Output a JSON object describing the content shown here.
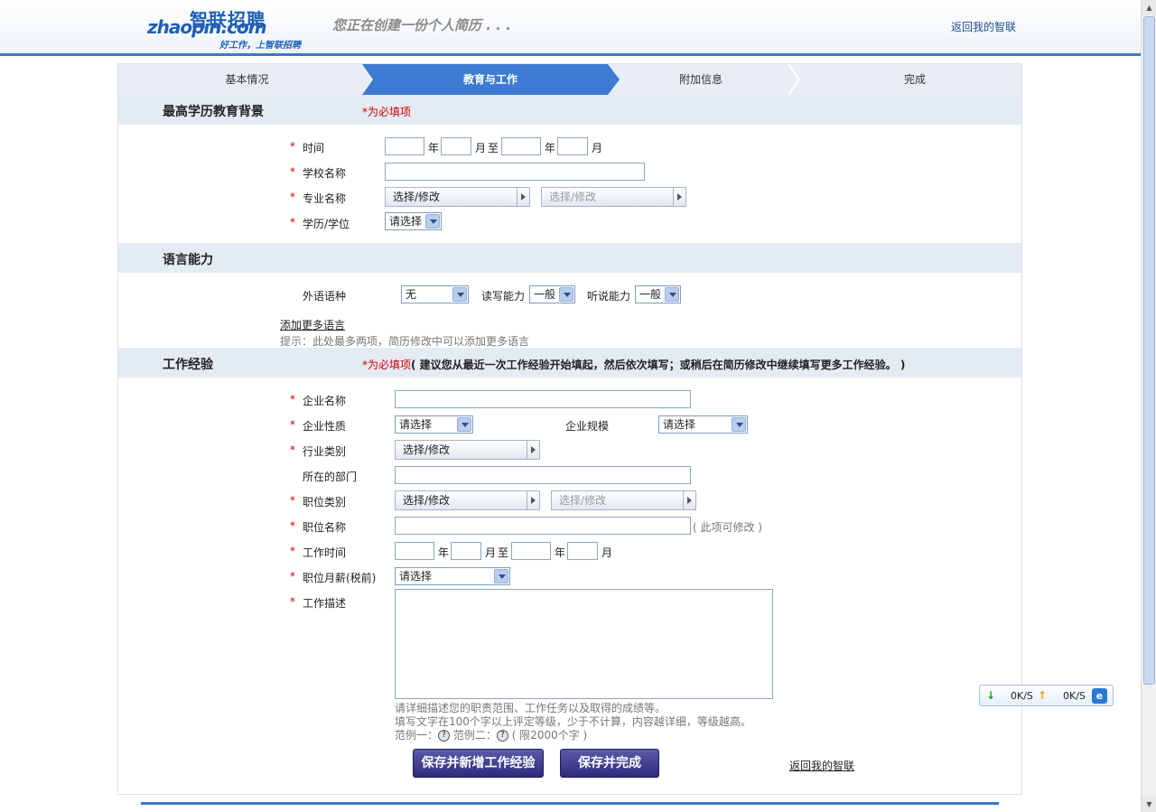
{
  "header": {
    "logo_cn": "智联招聘",
    "logo_en": "zhaopin.com",
    "logo_slogan": "好工作，上智联招聘",
    "tagline": "您正在创建一份个人简历 . . .",
    "back_link": "返回我的智联"
  },
  "steps": [
    {
      "label": "基本情况"
    },
    {
      "label": "教育与工作"
    },
    {
      "label": "附加信息"
    },
    {
      "label": "完成"
    }
  ],
  "education": {
    "title": "最高学历教育背景",
    "required_note": "*为必填项",
    "time_label": "时间",
    "year_unit": "年",
    "month_unit": "月",
    "to_label": "至",
    "school_label": "学校名称",
    "major_label": "专业名称",
    "major_picker1": "选择/修改",
    "major_picker2": "选择/修改",
    "degree_label": "学历/学位",
    "degree_value": "请选择"
  },
  "language": {
    "title": "语言能力",
    "foreign_label": "外语语种",
    "foreign_value": "无",
    "rw_label": "读写能力",
    "rw_value": "一般",
    "ls_label": "听说能力",
    "ls_value": "一般",
    "add_more": "添加更多语言",
    "hint": "提示：此处最多两项，简历修改中可以添加更多语言"
  },
  "work": {
    "title": "工作经验",
    "required_note": "*为必填项",
    "required_extra": "( 建议您从最近一次工作经验开始填起，然后依次填写；或稍后在简历修改中继续填写更多工作经验。 )",
    "company_label": "企业名称",
    "nature_label": "企业性质",
    "nature_value": "请选择",
    "scale_label": "企业规模",
    "scale_value": "请选择",
    "industry_label": "行业类别",
    "industry_picker": "选择/修改",
    "dept_label": "所在的部门",
    "position_cat_label": "职位类别",
    "position_picker1": "选择/修改",
    "position_picker2": "选择/修改",
    "position_name_label": "职位名称",
    "position_name_note": "( 此项可修改 )",
    "work_time_label": "工作时间",
    "year_unit": "年",
    "month_unit": "月",
    "to_label": "至",
    "salary_label": "职位月薪(税前)",
    "salary_value": "请选择",
    "desc_label": "工作描述",
    "desc_hint1": "请详细描述您的职责范围、工作任务以及取得的成绩等。",
    "desc_hint2": "填写文字在100个字以上评定等级，少于不计算，内容越详细，等级越高。",
    "example1": "范例一：",
    "example2": "范例二：",
    "limit": "( 限2000个字 )",
    "q_mark": "?"
  },
  "actions": {
    "save_add": "保存并新增工作经验",
    "save_finish": "保存并完成",
    "back_link": "返回我的智联"
  },
  "speed_widget": {
    "down_value": "0K/S",
    "up_value": "0K/S",
    "down_icon": "arrow-down-icon",
    "up_icon": "arrow-up-icon",
    "ie_label": "e"
  },
  "colors": {
    "accent": "#3a79c6",
    "required": "#cc0000",
    "button": "#2c2c7a"
  }
}
